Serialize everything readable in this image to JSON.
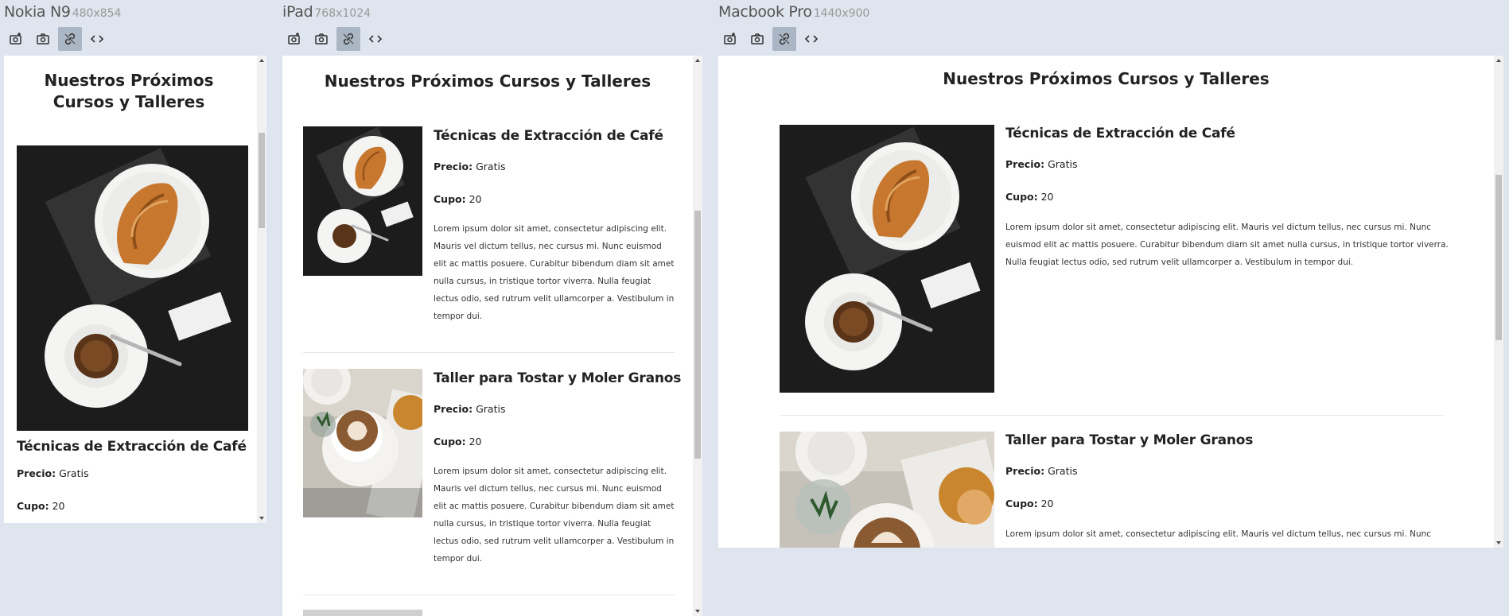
{
  "devices": [
    {
      "name": "Nokia N9",
      "size": "480x854"
    },
    {
      "name": "iPad",
      "size": "768x1024"
    },
    {
      "name": "Macbook Pro",
      "size": "1440x900"
    }
  ],
  "toolbar": {
    "icons": [
      "camera-plus-icon",
      "camera-icon",
      "link-icon",
      "code-icon"
    ]
  },
  "site": {
    "title": "Nuestros Próximos Cursos y Talleres",
    "price_label": "Precio:",
    "capacity_label": "Cupo:"
  },
  "courses": [
    {
      "title": "Técnicas de Extracción de Café",
      "price": "Gratis",
      "capacity": "20",
      "description": "Lorem ipsum dolor sit amet, consectetur adipiscing elit. Mauris vel dictum tellus, nec cursus mi. Nunc euismod elit ac mattis posuere. Curabitur bibendum diam sit amet nulla cursus, in tristique tortor viverra. Nulla feugiat lectus odio, sed rutrum velit ullamcorper a. Vestibulum in tempor dui."
    },
    {
      "title": "Taller para Tostar y Moler Granos",
      "price": "Gratis",
      "capacity": "20",
      "description": "Lorem ipsum dolor sit amet, consectetur adipiscing elit. Mauris vel dictum tellus, nec cursus mi. Nunc euismod elit ac mattis posuere. Curabitur bibendum diam sit amet nulla cursus, in tristique tortor viverra. Nulla feugiat lectus odio, sed rutrum velit ullamcorper a. Vestibulum in tempor dui."
    }
  ],
  "macbook_desc_line1": "Lorem ipsum dolor sit amet, consectetur adipiscing elit. Mauris vel dictum tellus, nec cursus mi. Nunc",
  "colors": {
    "background": "#dfe5ee",
    "active_tool": "#aab6c4"
  }
}
